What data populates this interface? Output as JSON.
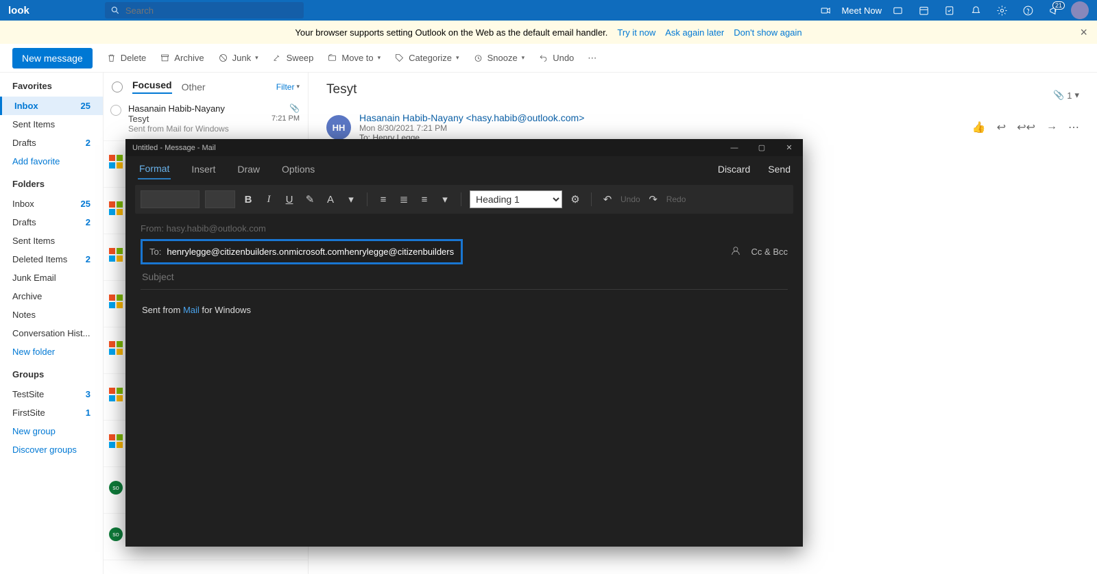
{
  "top": {
    "brand": "look",
    "search_ph": "Search",
    "meet_now": "Meet Now",
    "badge": "21"
  },
  "yellow": {
    "msg": "Your browser supports setting Outlook on the Web as the default email handler.",
    "try": "Try it now",
    "later": "Ask again later",
    "dont": "Don't show again"
  },
  "cmd": {
    "newmsg": "New message",
    "delete": "Delete",
    "archive": "Archive",
    "junk": "Junk",
    "sweep": "Sweep",
    "move": "Move to",
    "cat": "Categorize",
    "snooze": "Snooze",
    "undo": "Undo"
  },
  "nav": {
    "fav": "Favorites",
    "fav_items": [
      {
        "l": "Inbox",
        "c": "25",
        "active": true
      },
      {
        "l": "Sent Items",
        "c": ""
      },
      {
        "l": "Drafts",
        "c": "2"
      }
    ],
    "addfav": "Add favorite",
    "folders": "Folders",
    "fold_items": [
      {
        "l": "Inbox",
        "c": "25"
      },
      {
        "l": "Drafts",
        "c": "2"
      },
      {
        "l": "Sent Items",
        "c": ""
      },
      {
        "l": "Deleted Items",
        "c": "2"
      },
      {
        "l": "Junk Email",
        "c": ""
      },
      {
        "l": "Archive",
        "c": ""
      },
      {
        "l": "Notes",
        "c": ""
      },
      {
        "l": "Conversation Hist...",
        "c": ""
      }
    ],
    "newfolder": "New folder",
    "groups": "Groups",
    "grp_items": [
      {
        "l": "TestSite",
        "c": "3"
      },
      {
        "l": "FirstSite",
        "c": "1"
      }
    ],
    "newgroup": "New group",
    "discover": "Discover groups"
  },
  "mlist": {
    "focused": "Focused",
    "other": "Other",
    "filter": "Filter",
    "msg": {
      "from": "Hasanain Habib-Nayany",
      "subj": "Tesyt",
      "time": "7:21 PM",
      "prev": "Sent from Mail for Windows"
    }
  },
  "reading": {
    "subject": "Tesyt",
    "att": "1",
    "hh": "HH",
    "from": "Hasanain Habib-Nayany <hasy.habib@outlook.com>",
    "date": "Mon 8/30/2021 7:21 PM",
    "to": "To:  Henry Legge"
  },
  "compose": {
    "title": "Untitled - Message - Mail",
    "tabs": {
      "format": "Format",
      "insert": "Insert",
      "draw": "Draw",
      "options": "Options"
    },
    "discard": "Discard",
    "send": "Send",
    "heading_opt": "Heading 1",
    "undo": "Undo",
    "redo": "Redo",
    "from_lbl": "From:",
    "from_val": "hasy.habib@outlook.com",
    "to_lbl": "To:",
    "to_val": "henrylegge@citizenbuilders.onmicrosoft.comhenrylegge@citizenbuilders.onmic",
    "ccbcc": "Cc & Bcc",
    "subject_ph": "Subject",
    "body_pre": "Sent from ",
    "body_link": "Mail",
    "body_post": " for Windows"
  }
}
